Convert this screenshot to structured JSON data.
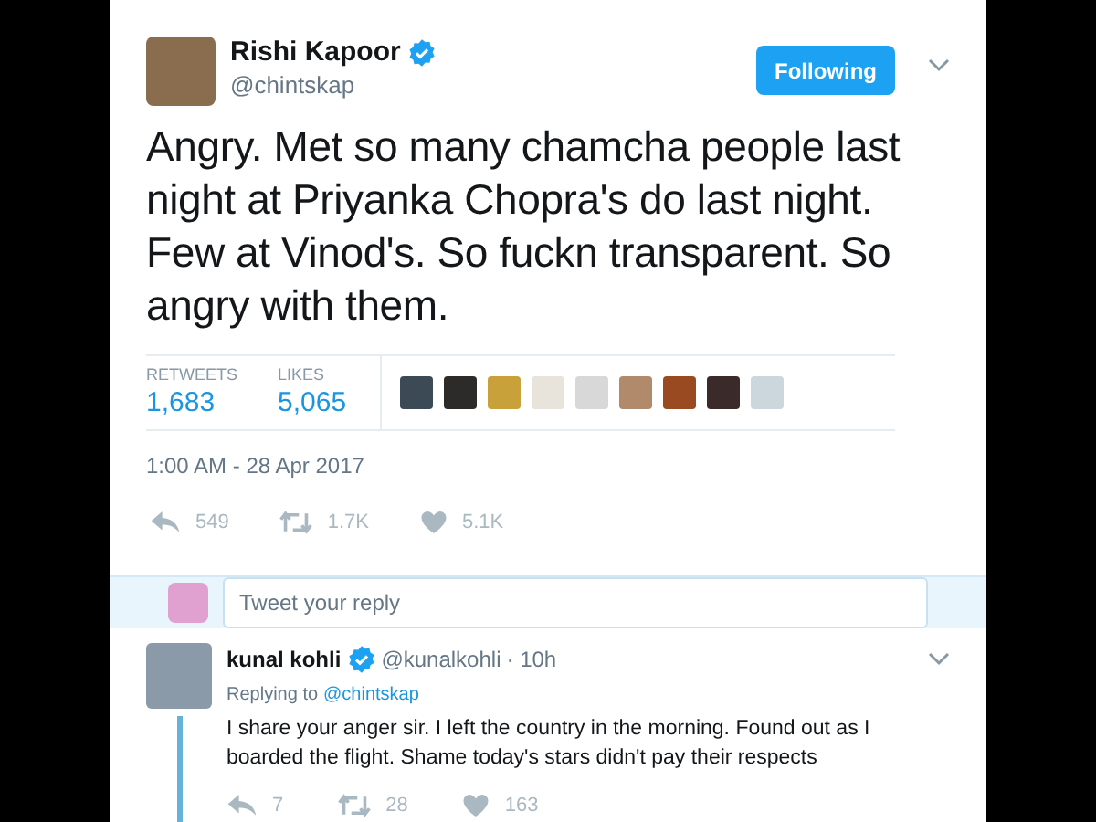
{
  "tweet": {
    "author": {
      "name": "Rishi Kapoor",
      "handle": "@chintskap",
      "verified": true
    },
    "follow_button": "Following",
    "text": "Angry. Met so many chamcha people last night at Priyanka Chopra's do last night. Few at Vinod's. So fuckn transparent. So angry with them.",
    "stats": [
      {
        "label": "RETWEETS",
        "value": "1,683"
      },
      {
        "label": "LIKES",
        "value": "5,065"
      }
    ],
    "timestamp": "1:00 AM - 28 Apr 2017",
    "actions": [
      {
        "kind": "reply",
        "count": "549"
      },
      {
        "kind": "retweet",
        "count": "1.7K"
      },
      {
        "kind": "like",
        "count": "5.1K"
      }
    ]
  },
  "reply_box": {
    "placeholder": "Tweet your reply"
  },
  "replies": [
    {
      "name": "kunal kohli",
      "verified": true,
      "handle": "@kunalkohli",
      "time": "· 10h",
      "replying_label": "Replying to",
      "replying_to": "@chintskap",
      "text": "I share your anger sir. I left the country in the morning. Found out as I boarded the flight. Shame today's stars didn't pay their respects",
      "actions": [
        {
          "kind": "reply",
          "count": "7"
        },
        {
          "kind": "retweet",
          "count": "28"
        },
        {
          "kind": "like",
          "count": "163"
        }
      ]
    }
  ]
}
